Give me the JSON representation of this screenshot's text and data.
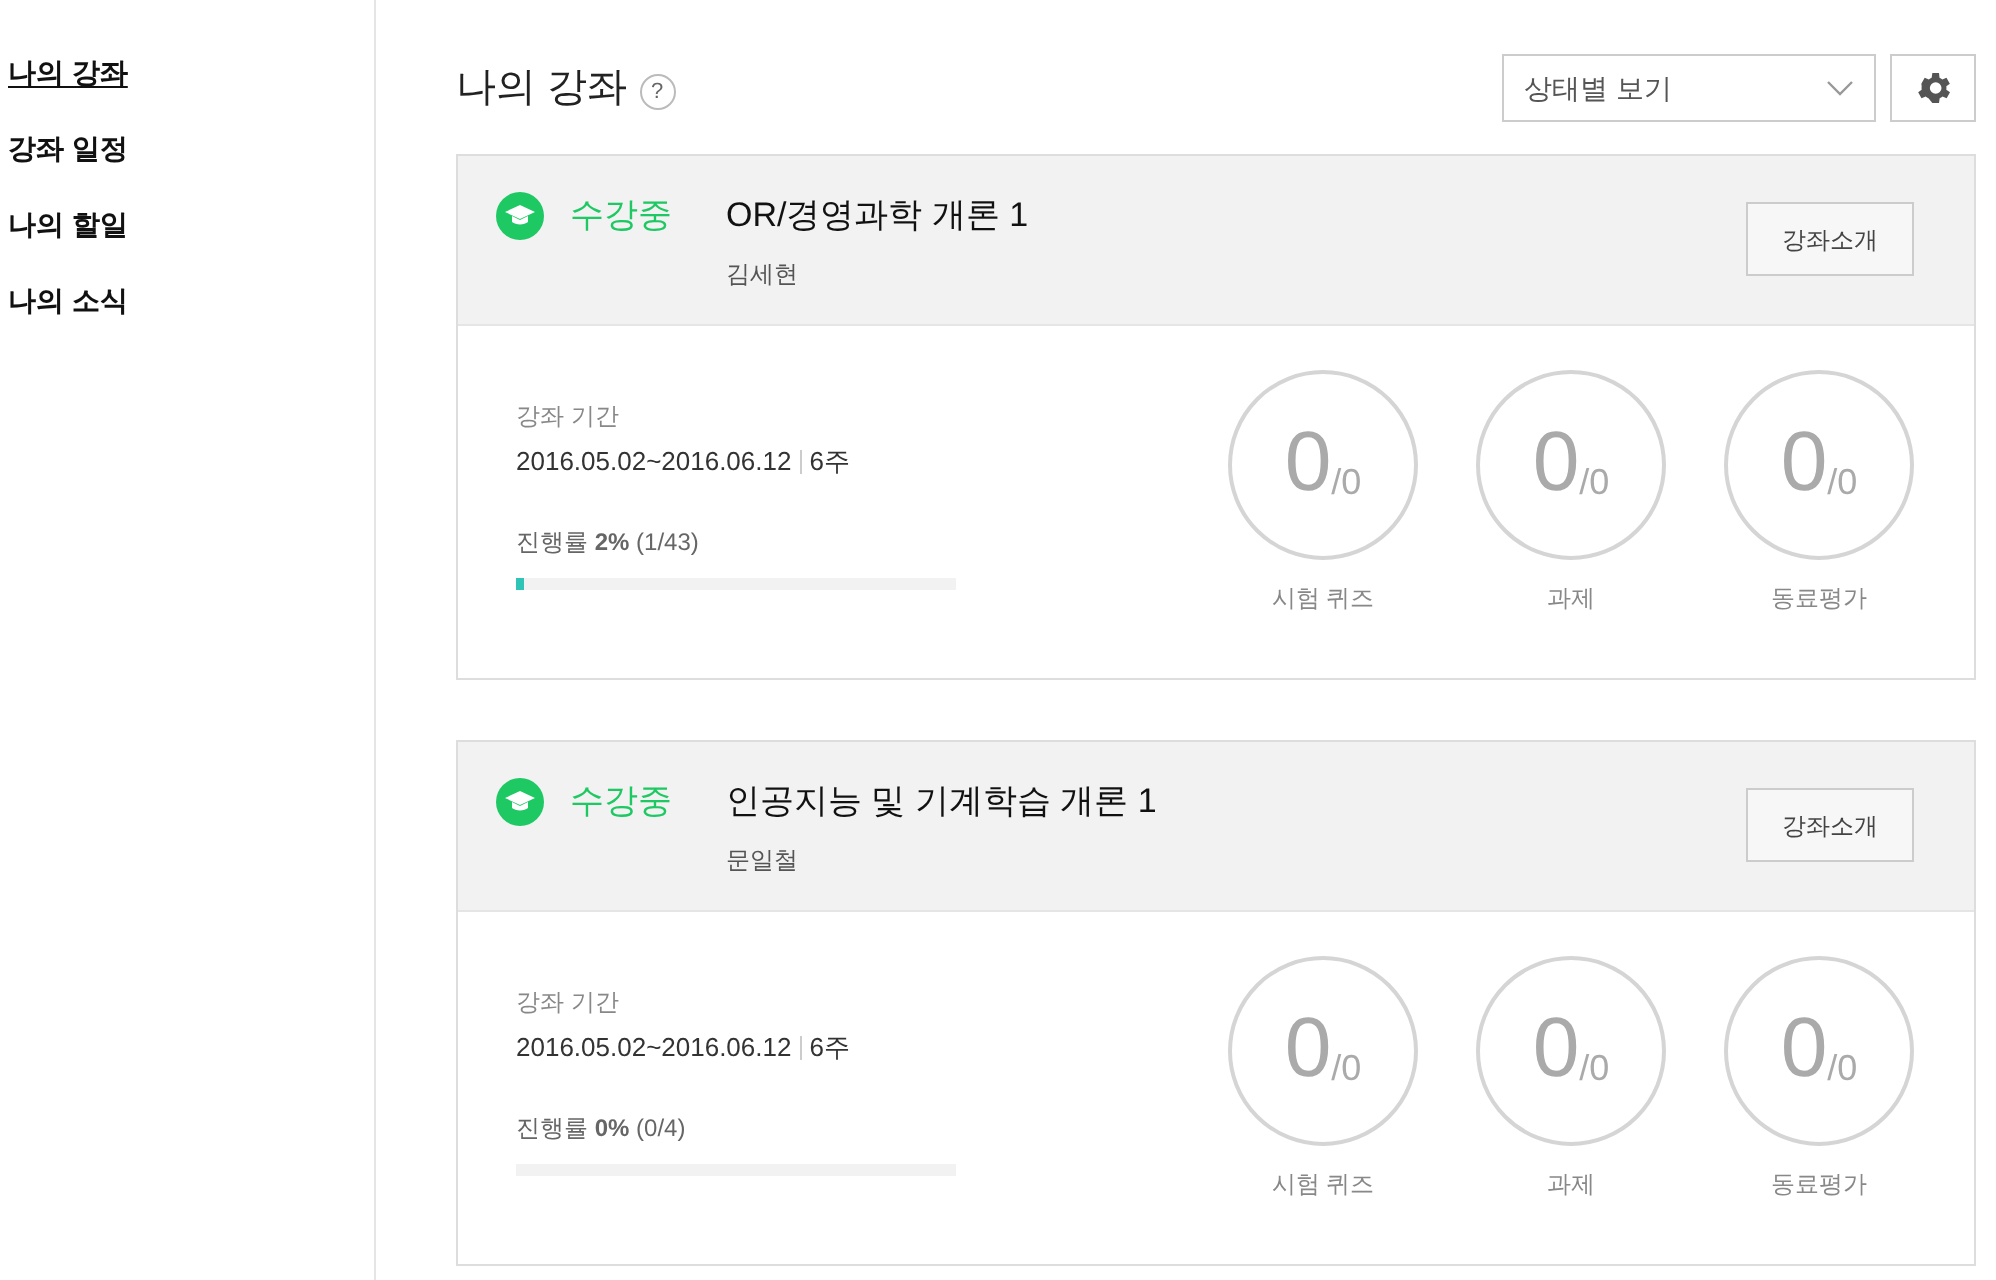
{
  "sidebar": {
    "items": [
      {
        "label": "나의 강좌",
        "selected": true
      },
      {
        "label": "강좌 일정",
        "selected": false
      },
      {
        "label": "나의 할일",
        "selected": false
      },
      {
        "label": "나의 소식",
        "selected": false
      }
    ]
  },
  "header": {
    "title": "나의 강좌",
    "help": "?",
    "filter": "상태별 보기"
  },
  "courses": [
    {
      "status": "수강중",
      "title": "OR/경영과학 개론 1",
      "instructor": "김세현",
      "intro_button": "강좌소개",
      "period_label": "강좌 기간",
      "period": "2016.05.02~2016.06.12",
      "weeks": "6주",
      "progress": "진행률 **2%** (1/43)",
      "level": 0.02,
      "stats": [
        {
          "value": "0",
          "total": "/0",
          "label": "시험 퀴즈"
        },
        {
          "value": "0",
          "total": "/0",
          "label": "과제"
        },
        {
          "value": "0",
          "total": "/0",
          "label": "동료평가"
        }
      ]
    },
    {
      "status": "수강중",
      "title": "인공지능 및 기계학습 개론 1",
      "instructor": "문일철",
      "intro_button": "강좌소개",
      "period_label": "강좌 기간",
      "period": "2016.05.02~2016.06.12",
      "weeks": "6주",
      "progress": "진행률 **0%** (0/4)",
      "level": 0,
      "stats": [
        {
          "value": "0",
          "total": "/0",
          "label": "시험 퀴즈"
        },
        {
          "value": "0",
          "total": "/0",
          "label": "과제"
        },
        {
          "value": "0",
          "total": "/0",
          "label": "동료평가"
        }
      ]
    }
  ]
}
